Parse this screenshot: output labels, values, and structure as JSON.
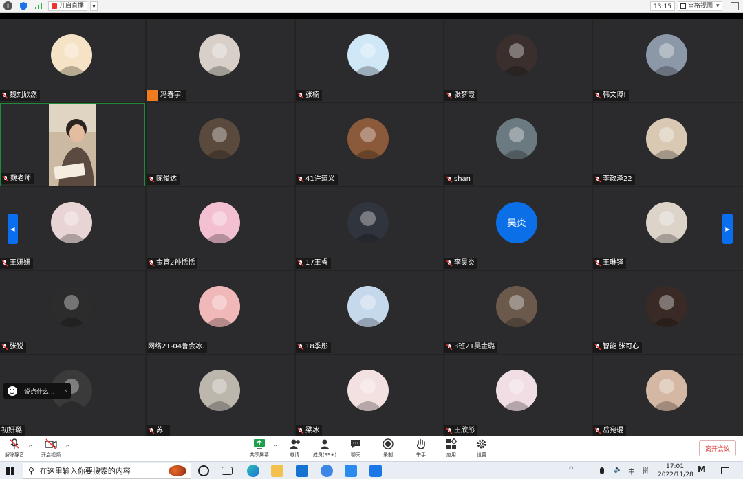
{
  "topbar": {
    "live_label": "开启直播",
    "time": "13:15",
    "view_label": "宫格视图"
  },
  "participants": [
    {
      "name": "魏刘欣然",
      "avatar": "cartoon-girl",
      "bg": "#f6e2c4"
    },
    {
      "name": "冯春宇.",
      "avatar": "photo",
      "bg": "#d7cfc8",
      "host": true
    },
    {
      "name": "张楠",
      "avatar": "doraemon",
      "bg": "#cfe7f7"
    },
    {
      "name": "张梦霞",
      "avatar": "photo",
      "bg": "#3a2f2c"
    },
    {
      "name": "韩文博!",
      "avatar": "photo",
      "bg": "#8c98a8"
    },
    {
      "name": "魏老师",
      "avatar": "video",
      "bg": "#8c7a66",
      "video": true
    },
    {
      "name": "陈俊达",
      "avatar": "anime",
      "bg": "#5a4a3e"
    },
    {
      "name": "41许道义",
      "avatar": "photo",
      "bg": "#8a5a3a"
    },
    {
      "name": "shan",
      "avatar": "photo",
      "bg": "#6b7a80"
    },
    {
      "name": "李政泽22",
      "avatar": "teddy",
      "bg": "#d9c9b3"
    },
    {
      "name": "王妍妍",
      "avatar": "anime",
      "bg": "#e8d4d4"
    },
    {
      "name": "金管2孙恬恬",
      "avatar": "dog",
      "bg": "#f2c0d0"
    },
    {
      "name": "17王睿",
      "avatar": "photo",
      "bg": "#30343c"
    },
    {
      "name": "李昊炎",
      "avatar_text": "昊炎",
      "bg": "#0b6fe8"
    },
    {
      "name": "王琳铎",
      "avatar": "teddy",
      "bg": "#dcd3c9"
    },
    {
      "name": "张锐",
      "avatar": "photo",
      "bg": "#2c2c2c"
    },
    {
      "name": "网络21-04鲁会冰.",
      "avatar": "cartoon",
      "bg": "#f0b8b8",
      "no_mic": true
    },
    {
      "name": "18季彤",
      "avatar": "bird",
      "bg": "#c6d9ec"
    },
    {
      "name": "3班21吴金璐",
      "avatar": "photo",
      "bg": "#6b5a4c"
    },
    {
      "name": "智能 张可心",
      "avatar": "photo",
      "bg": "#3a2a26"
    },
    {
      "name": "初妍璐",
      "avatar": "photo",
      "bg": "#3a3a3a",
      "no_mic": true
    },
    {
      "name": "苏L",
      "avatar": "photo",
      "bg": "#bdb6ad"
    },
    {
      "name": "梁冰",
      "avatar": "anime",
      "bg": "#f3e0e0"
    },
    {
      "name": "王欣彤",
      "avatar": "anime",
      "bg": "#f1dde4"
    },
    {
      "name": "岳宛琨",
      "avatar": "photo",
      "bg": "#d4b8a4"
    }
  ],
  "chat_placeholder": "说点什么...",
  "toolbar": {
    "mute": "解除静音",
    "video": "开启视频",
    "share": "共享屏幕",
    "invite": "邀请",
    "members": "成员(99+)",
    "chat": "聊天",
    "record": "录制",
    "raise_hand": "举手",
    "apps": "应用",
    "settings": "设置",
    "leave": "离开会议"
  },
  "taskbar": {
    "search_placeholder": "在这里输入你要搜索的内容",
    "ime": "中",
    "ime2": "拼",
    "clock_time": "17:01",
    "clock_date": "2022/11/28"
  },
  "colors": {
    "accent": "#0b6fe8",
    "host": "#f07c21",
    "leave": "#e03b3b"
  }
}
